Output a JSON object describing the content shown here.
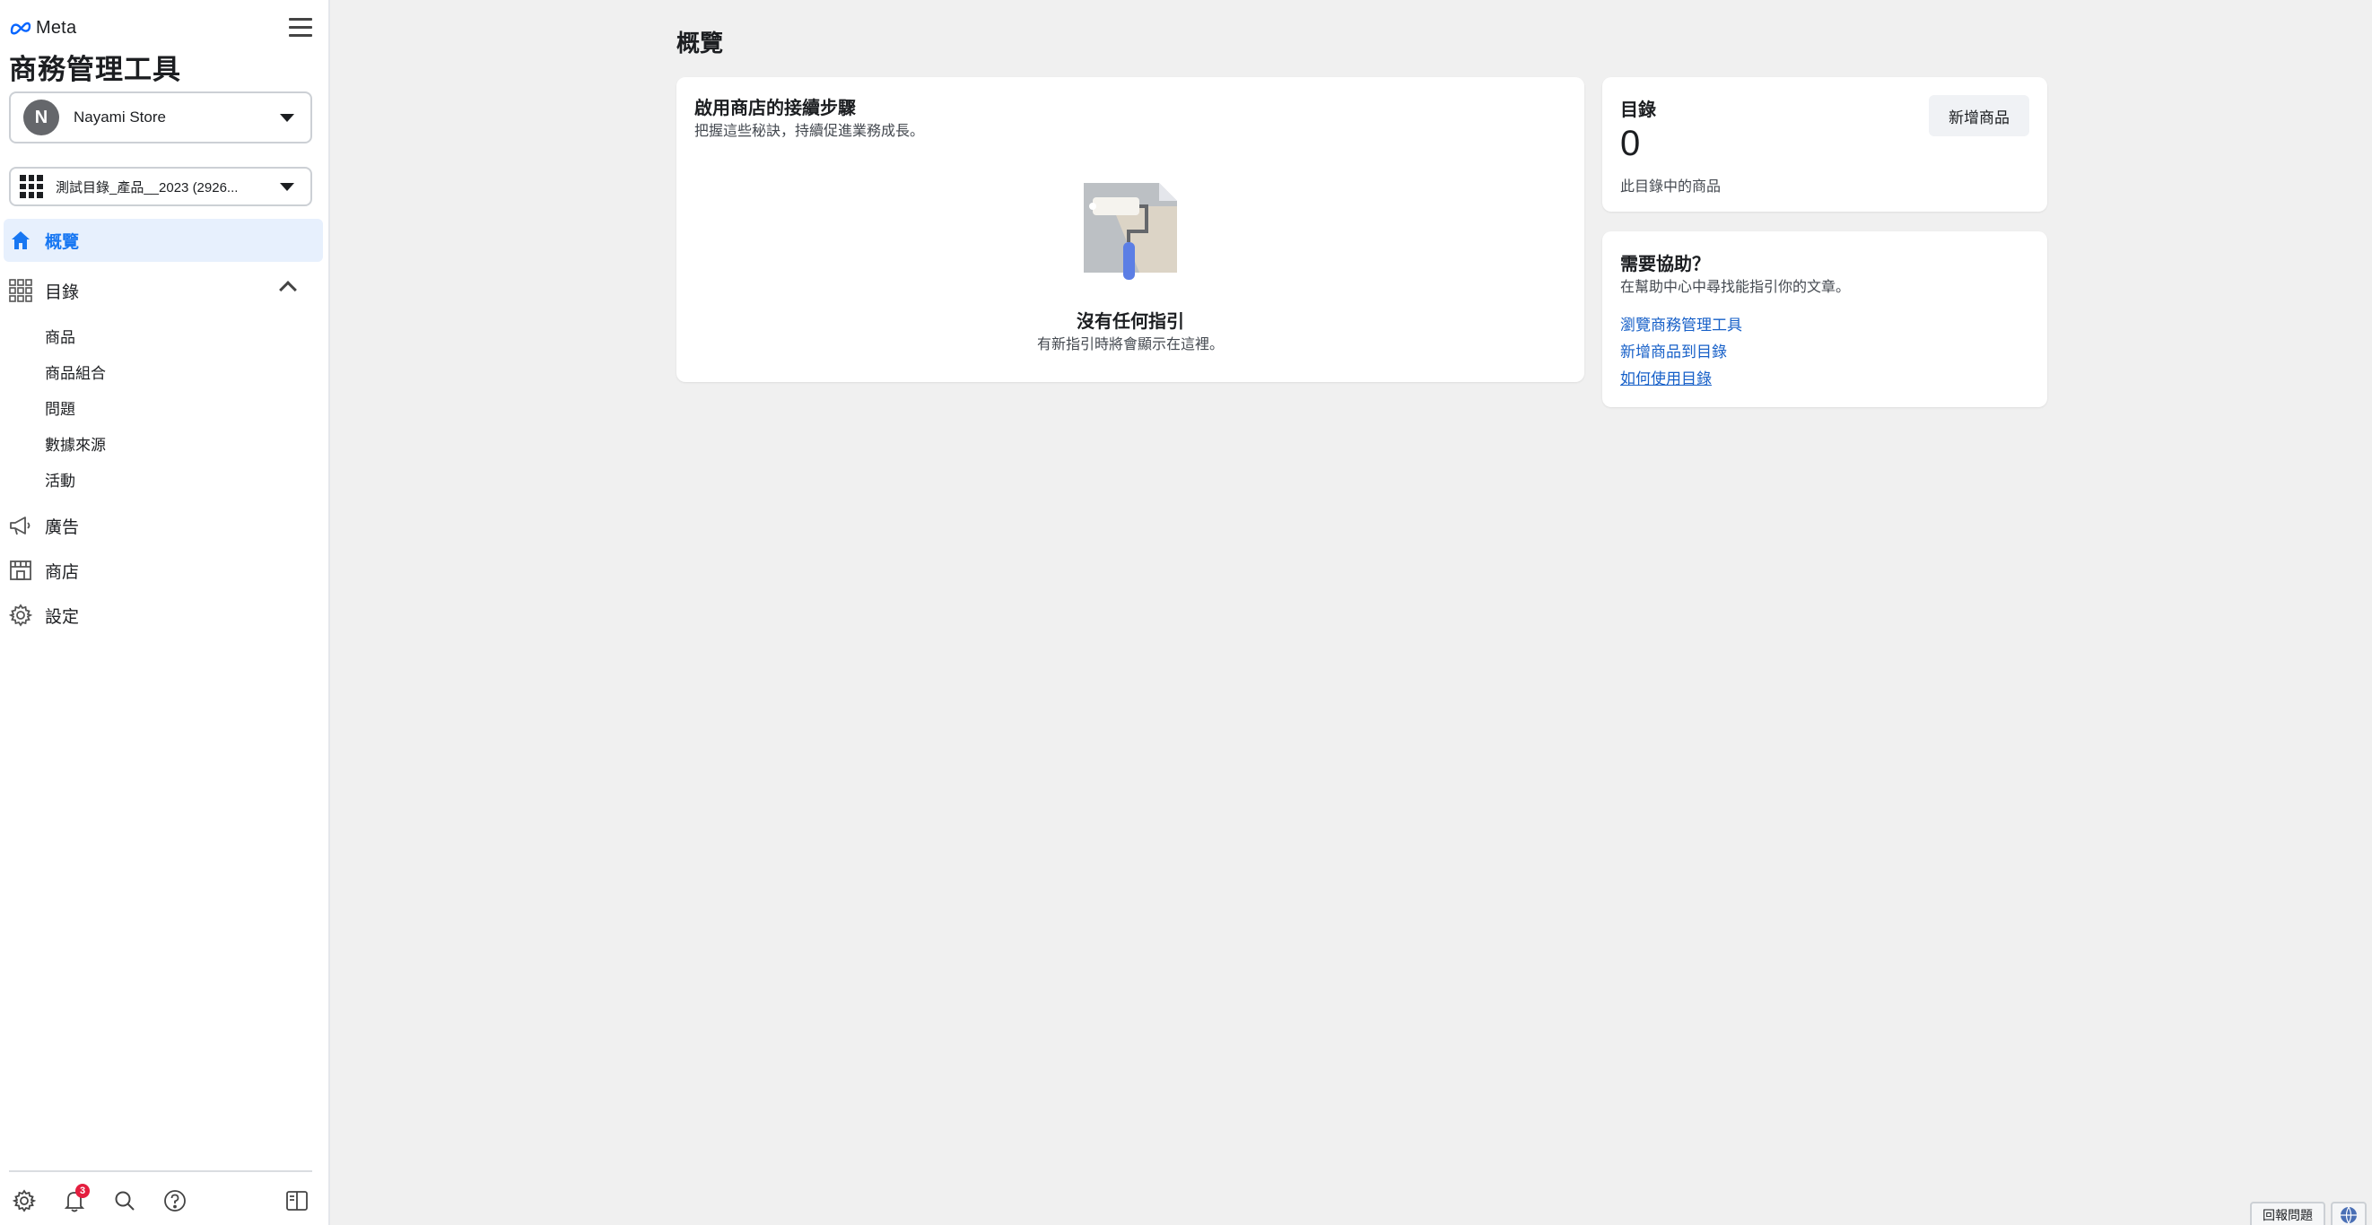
{
  "sidebar": {
    "brand": "Meta",
    "title": "商務管理工具",
    "store": {
      "initial": "N",
      "name": "Nayami Store"
    },
    "catalog": {
      "name": "測試目錄_產品__2023 (2926..."
    },
    "nav": {
      "overview": "概覽",
      "catalog": "目錄",
      "ads": "廣告",
      "shop": "商店",
      "settings": "設定"
    },
    "catalog_sub": [
      "商品",
      "商品組合",
      "問題",
      "數據來源",
      "活動"
    ],
    "notification_count": "3"
  },
  "main": {
    "page_title": "概覽",
    "steps_card": {
      "title": "啟用商店的接續步驟",
      "subtitle": "把握這些秘訣，持續促進業務成長。",
      "empty_title": "沒有任何指引",
      "empty_subtitle": "有新指引時將會顯示在這裡。"
    },
    "catalog_card": {
      "title": "目錄",
      "count": "0",
      "caption": "此目錄中的商品",
      "add_button": "新增商品"
    },
    "help_card": {
      "title": "需要協助？",
      "subtitle": "在幫助中心中尋找能指引你的文章。",
      "links": [
        "瀏覽商務管理工具",
        "新增商品到目錄",
        "如何使用目錄"
      ]
    }
  },
  "footer": {
    "report": "回報問題"
  },
  "colors": {
    "accent": "#1877f2",
    "link": "#1760c8",
    "active_bg": "#e7f0fd"
  }
}
